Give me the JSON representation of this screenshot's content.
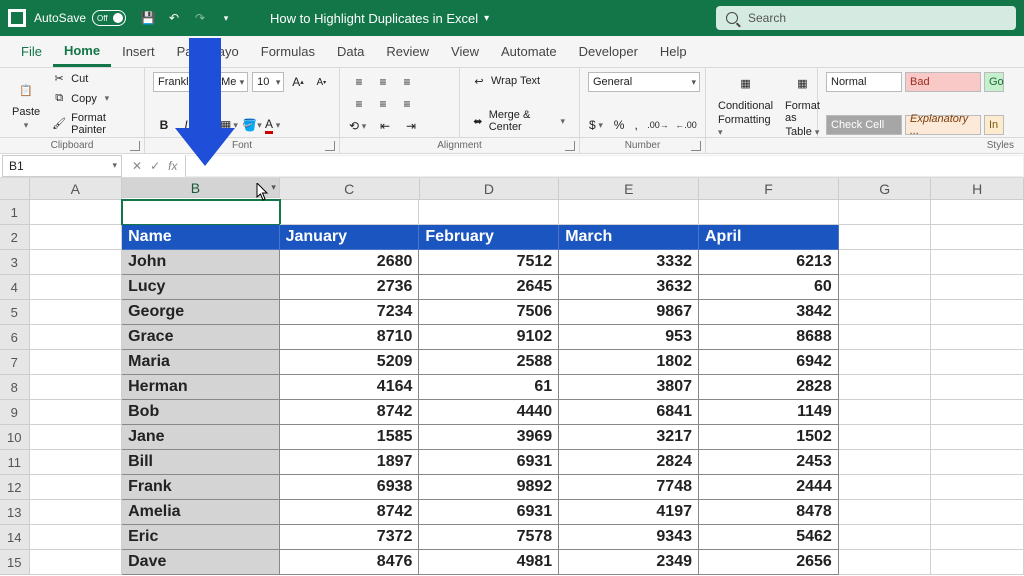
{
  "title": {
    "autosave": "AutoSave",
    "autosave_state": "Off",
    "doc": "How to Highlight Duplicates in Excel",
    "search_placeholder": "Search"
  },
  "menu": {
    "file": "File",
    "home": "Home",
    "insert": "Insert",
    "page": "Page Layo",
    "formulas": "Formulas",
    "data": "Data",
    "review": "Review",
    "view": "View",
    "automate": "Automate",
    "developer": "Developer",
    "help": "Help"
  },
  "ribbon": {
    "clipboard": {
      "paste": "Paste",
      "cut": "Cut",
      "copy": "Copy",
      "fmtpainter": "Format Painter",
      "label": "Clipboard"
    },
    "font": {
      "name": "Franklin",
      "me": "Me",
      "size": "10",
      "label": "Font"
    },
    "align": {
      "wrap": "Wrap Text",
      "merge": "Merge & Center",
      "label": "Alignment"
    },
    "number": {
      "fmt": "General",
      "label": "Number"
    },
    "styles": {
      "cond": "Conditional",
      "cond2": "Formatting",
      "fmtas": "Format as",
      "fmtas2": "Table",
      "normal": "Normal",
      "bad": "Bad",
      "good": "Go",
      "check": "Check Cell",
      "exp": "Explanatory ...",
      "inp": "In",
      "label": "Styles"
    }
  },
  "fbar": {
    "name": "B1"
  },
  "cols": {
    "a": "A",
    "b": "B",
    "c": "C",
    "d": "D",
    "e": "E",
    "f": "F",
    "g": "G",
    "h": "H"
  },
  "rows": [
    "1",
    "2",
    "3",
    "4",
    "5",
    "6",
    "7",
    "8",
    "9",
    "10",
    "11",
    "12",
    "13",
    "14",
    "15"
  ],
  "header": {
    "name": "Name",
    "jan": "January",
    "feb": "February",
    "mar": "March",
    "apr": "April"
  },
  "chart_data": {
    "type": "table",
    "columns": [
      "Name",
      "January",
      "February",
      "March",
      "April"
    ],
    "rows": [
      {
        "Name": "John",
        "January": 2680,
        "February": 7512,
        "March": 3332,
        "April": 6213
      },
      {
        "Name": "Lucy",
        "January": 2736,
        "February": 2645,
        "March": 3632,
        "April": 60
      },
      {
        "Name": "George",
        "January": 7234,
        "February": 7506,
        "March": 9867,
        "April": 3842
      },
      {
        "Name": "Grace",
        "January": 8710,
        "February": 9102,
        "March": 953,
        "April": 8688
      },
      {
        "Name": "Maria",
        "January": 5209,
        "February": 2588,
        "March": 1802,
        "April": 6942
      },
      {
        "Name": "Herman",
        "January": 4164,
        "February": 61,
        "March": 3807,
        "April": 2828
      },
      {
        "Name": "Bob",
        "January": 8742,
        "February": 4440,
        "March": 6841,
        "April": 1149
      },
      {
        "Name": "Jane",
        "January": 1585,
        "February": 3969,
        "March": 3217,
        "April": 1502
      },
      {
        "Name": "Bill",
        "January": 1897,
        "February": 6931,
        "March": 2824,
        "April": 2453
      },
      {
        "Name": "Frank",
        "January": 6938,
        "February": 9892,
        "March": 7748,
        "April": 2444
      },
      {
        "Name": "Amelia",
        "January": 8742,
        "February": 6931,
        "March": 4197,
        "April": 8478
      },
      {
        "Name": "Eric",
        "January": 7372,
        "February": 7578,
        "March": 9343,
        "April": 5462
      },
      {
        "Name": "Dave",
        "January": 8476,
        "February": 4981,
        "March": 2349,
        "April": 2656
      }
    ]
  }
}
